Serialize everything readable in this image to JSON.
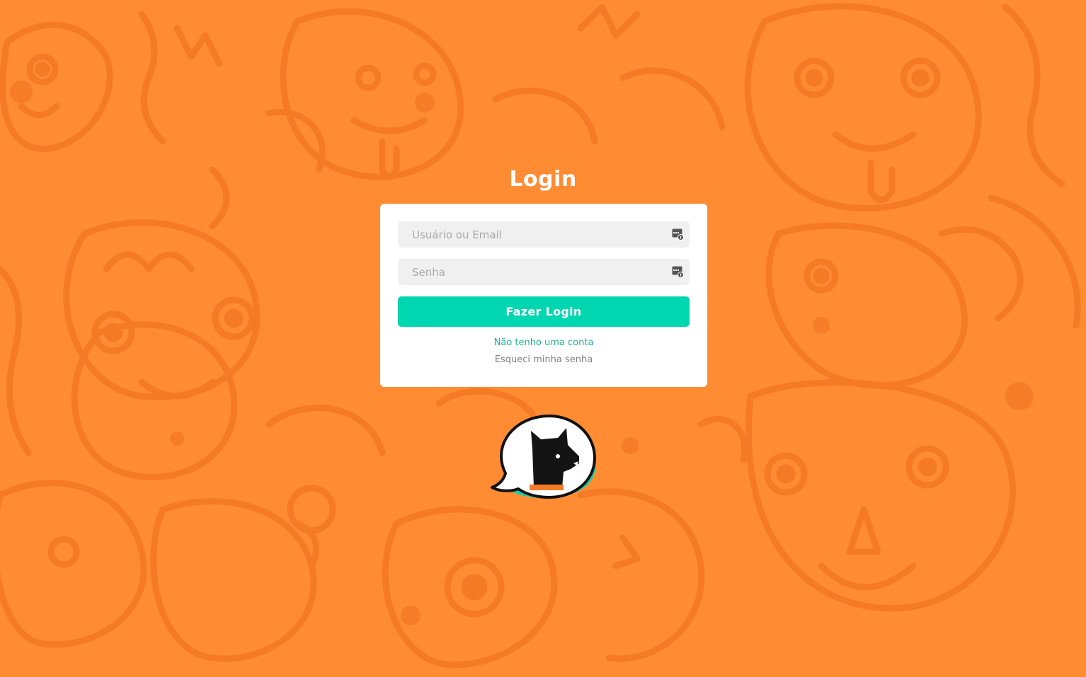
{
  "page": {
    "title": "Login",
    "background_color": "#ff8c33",
    "pattern_color": "#f57a26"
  },
  "form": {
    "username_placeholder": "Usuário ou Email",
    "password_placeholder": "Senha",
    "submit_label": "Fazer Login",
    "register_link": "Não tenho uma conta",
    "forgot_link": "Esqueci minha senha",
    "field_icon": "password-manager-icon"
  },
  "colors": {
    "accent": "#00d6b0",
    "link": "#17b596",
    "muted_link": "#808080",
    "card": "#ffffff",
    "field": "#f0f0f0"
  },
  "logo": {
    "icon": "dog-speech-bubble-logo"
  }
}
